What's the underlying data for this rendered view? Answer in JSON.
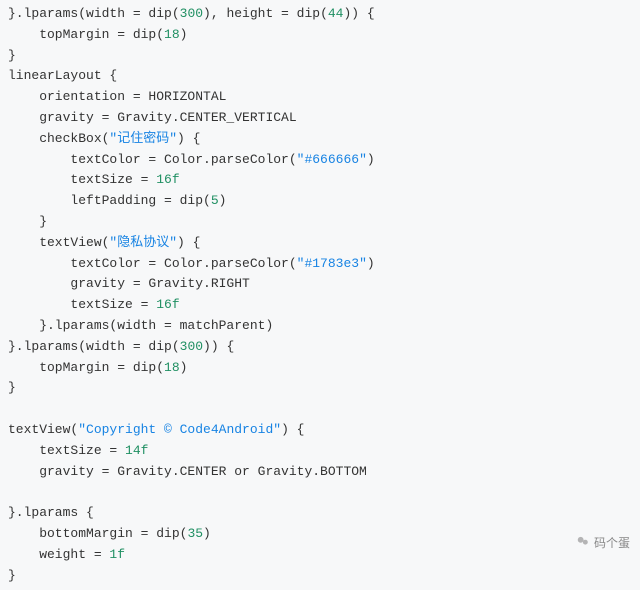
{
  "code": {
    "l1": "}.lparams(width = dip(",
    "l1n1": "300",
    "l1b": "), height = dip(",
    "l1n2": "44",
    "l1c": ")) {",
    "l2": "    topMargin = dip(",
    "l2n": "18",
    "l2b": ")",
    "l3": "}",
    "l4": "linearLayout {",
    "l5": "    orientation = HORIZONTAL",
    "l6": "    gravity = Gravity.CENTER_VERTICAL",
    "l7a": "    checkBox(",
    "l7s": "\"记住密码\"",
    "l7b": ") {",
    "l8a": "        textColor = Color.parseColor(",
    "l8s": "\"#666666\"",
    "l8b": ")",
    "l9a": "        textSize = ",
    "l9n": "16f",
    "l10a": "        leftPadding = dip(",
    "l10n": "5",
    "l10b": ")",
    "l11": "    }",
    "l12a": "    textView(",
    "l12s": "\"隐私协议\"",
    "l12b": ") {",
    "l13a": "        textColor = Color.parseColor(",
    "l13s": "\"#1783e3\"",
    "l13b": ")",
    "l14": "        gravity = Gravity.RIGHT",
    "l15a": "        textSize = ",
    "l15n": "16f",
    "l16": "    }.lparams(width = matchParent)",
    "l17a": "}.lparams(width = dip(",
    "l17n": "300",
    "l17b": ")) {",
    "l18a": "    topMargin = dip(",
    "l18n": "18",
    "l18b": ")",
    "l19": "}",
    "blank1": "",
    "l20a": "textView(",
    "l20s": "\"Copyright © Code4Android\"",
    "l20b": ") {",
    "l21a": "    textSize = ",
    "l21n": "14f",
    "l22": "    gravity = Gravity.CENTER or Gravity.BOTTOM",
    "blank2": "",
    "l23": "}.lparams {",
    "l24a": "    bottomMargin = dip(",
    "l24n": "35",
    "l24b": ")",
    "l25a": "    weight = ",
    "l25n": "1f",
    "l26": "}"
  },
  "watermark": {
    "label": "码个蛋"
  }
}
